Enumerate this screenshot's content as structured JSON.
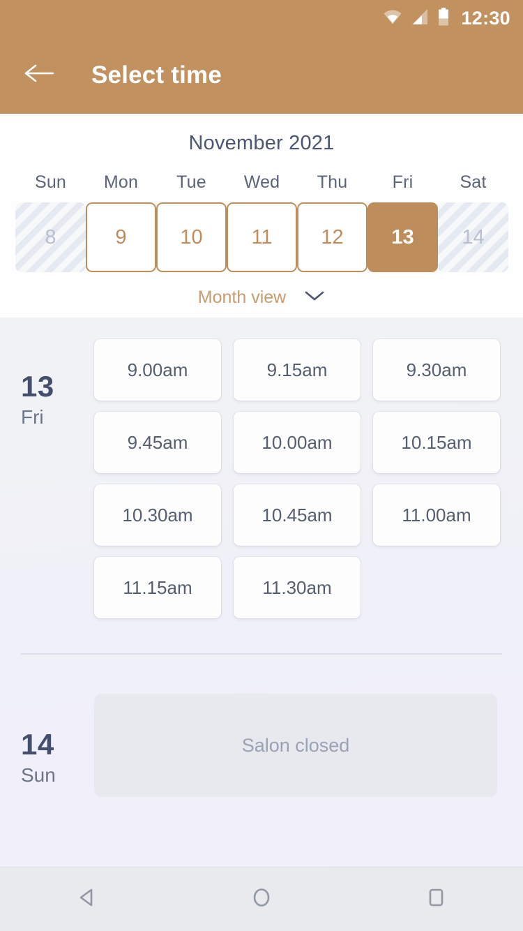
{
  "status_bar": {
    "time": "12:30",
    "icons": [
      "wifi-icon",
      "cellular-signal-icon",
      "battery-icon"
    ]
  },
  "app_bar": {
    "back_icon": "arrow-left-icon",
    "title": "Select time",
    "background_color": "#c1925f",
    "text_color": "#ffffff"
  },
  "calendar": {
    "month_title": "November 2021",
    "weekday_headers": [
      "Sun",
      "Mon",
      "Tue",
      "Wed",
      "Thu",
      "Fri",
      "Sat"
    ],
    "days": [
      {
        "number": "8",
        "state": "disabled"
      },
      {
        "number": "9",
        "state": "available"
      },
      {
        "number": "10",
        "state": "available"
      },
      {
        "number": "11",
        "state": "available"
      },
      {
        "number": "12",
        "state": "available"
      },
      {
        "number": "13",
        "state": "selected"
      },
      {
        "number": "14",
        "state": "disabled"
      }
    ],
    "view_toggle": {
      "label": "Month view",
      "chevron_icon": "chevron-down-icon"
    },
    "accent_color": "#bd8e5c"
  },
  "schedule": {
    "days": [
      {
        "day_number": "13",
        "day_name": "Fri",
        "slots": [
          "9.00am",
          "9.15am",
          "9.30am",
          "9.45am",
          "10.00am",
          "10.15am",
          "10.30am",
          "10.45am",
          "11.00am",
          "11.15am",
          "11.30am"
        ],
        "closed_message": null
      },
      {
        "day_number": "14",
        "day_name": "Sun",
        "slots": [],
        "closed_message": "Salon closed"
      }
    ]
  },
  "nav_bar": {
    "buttons": [
      {
        "name": "back-nav-button",
        "icon": "triangle-left-icon"
      },
      {
        "name": "home-nav-button",
        "icon": "circle-icon"
      },
      {
        "name": "recents-nav-button",
        "icon": "square-icon"
      }
    ]
  }
}
